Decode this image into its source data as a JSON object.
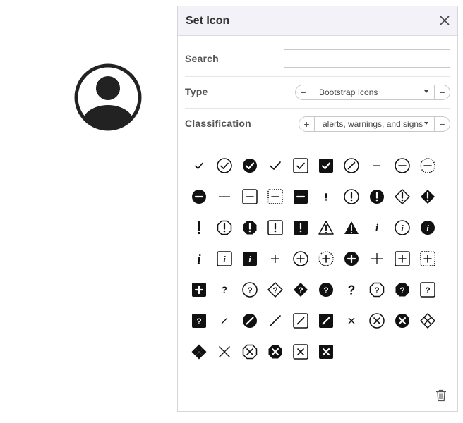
{
  "panel": {
    "title": "Set Icon",
    "search_label": "Search",
    "search_value": "",
    "type_label": "Type",
    "type_value": "Bootstrap Icons",
    "classification_label": "Classification",
    "classification_value": "alerts, warnings, and signs",
    "plus_glyph": "+",
    "minus_glyph": "−"
  },
  "icons": [
    "check-icon",
    "check-circle-icon",
    "check-circle-fill-icon",
    "check-lg-icon",
    "check-square-icon",
    "check-square-fill-icon",
    "slash-circle-icon",
    "dash-icon",
    "dash-circle-icon",
    "dash-circle-dotted-icon",
    "dash-circle-fill-icon",
    "dash-lg-icon",
    "dash-square-icon",
    "dash-square-dotted-icon",
    "dash-square-fill-icon",
    "exclamation-icon",
    "exclamation-circle-icon",
    "exclamation-circle-fill-icon",
    "exclamation-diamond-icon",
    "exclamation-diamond-fill-icon",
    "exclamation-lg-icon",
    "exclamation-octagon-icon",
    "exclamation-octagon-fill-icon",
    "exclamation-square-icon",
    "exclamation-square-fill-icon",
    "exclamation-triangle-icon",
    "exclamation-triangle-fill-icon",
    "info-icon",
    "info-circle-icon",
    "info-circle-fill-icon",
    "info-lg-icon",
    "info-square-icon",
    "info-square-fill-icon",
    "plus-icon",
    "plus-circle-icon",
    "plus-circle-dotted-icon",
    "plus-circle-fill-icon",
    "plus-lg-icon",
    "plus-square-icon",
    "plus-square-dotted-icon",
    "plus-square-fill-icon",
    "question-icon",
    "question-circle-icon",
    "question-diamond-icon",
    "question-diamond-fill-icon",
    "question-circle-fill-icon",
    "question-lg-icon",
    "question-octagon-icon",
    "question-octagon-fill-icon",
    "question-square-icon",
    "question-square-fill-icon",
    "slash-icon",
    "slash-circle-fill-icon",
    "slash-lg-icon",
    "slash-square-icon",
    "slash-square-fill-icon",
    "x-icon",
    "x-circle-icon",
    "x-circle-fill-icon",
    "x-diamond-icon",
    "x-diamond-fill-icon",
    "x-lg-icon",
    "x-octagon-icon",
    "x-octagon-fill-icon",
    "x-square-icon",
    "x-square-fill-icon"
  ]
}
